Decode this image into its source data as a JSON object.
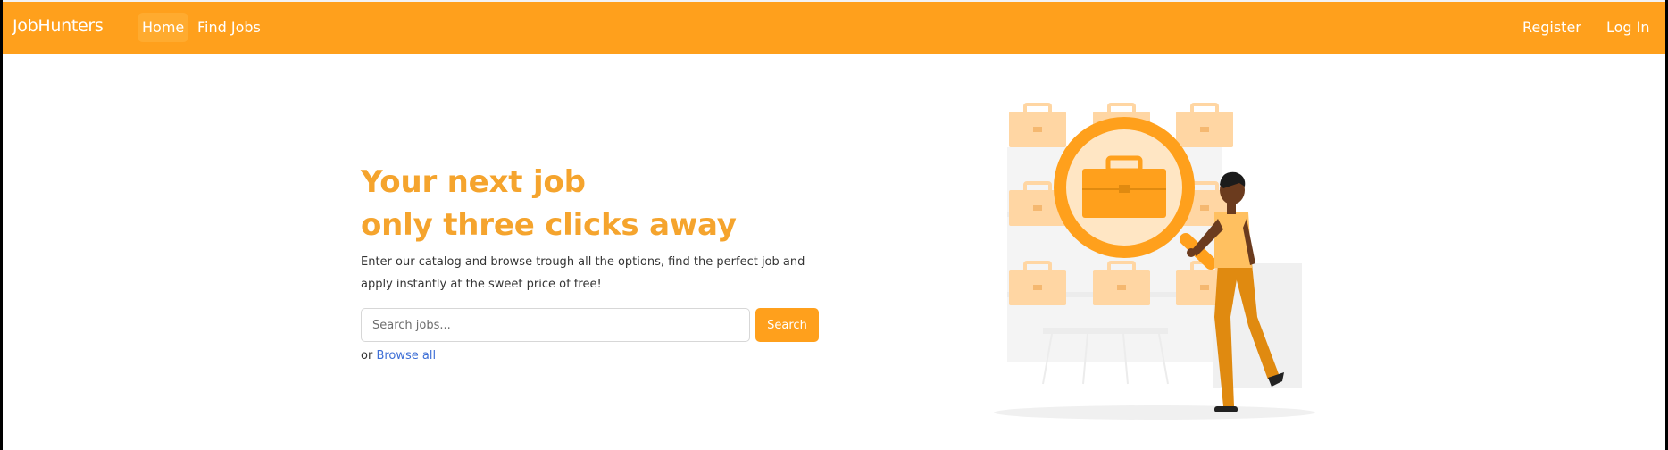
{
  "navbar": {
    "brand": "JobHunters",
    "links": [
      {
        "label": "Home"
      },
      {
        "label": "Find Jobs"
      }
    ],
    "right_links": [
      {
        "label": "Register"
      },
      {
        "label": "Log In"
      }
    ],
    "color": "#FFA01C"
  },
  "hero": {
    "title_line1": "Your next job",
    "title_line2": "only three clicks away",
    "subtitle_line1": "Enter our catalog and browse trough all the options, find the perfect job and",
    "subtitle_line2": "apply instantly at the sweet price of free!",
    "search_placeholder": "Search jobs...",
    "search_button": "Search",
    "browse_prefix": "or",
    "browse_link": "Browse all",
    "title_color": "#F5A42D",
    "link_color": "#3E6FD6"
  },
  "illustration": {
    "icon": "job-search-illustration"
  }
}
